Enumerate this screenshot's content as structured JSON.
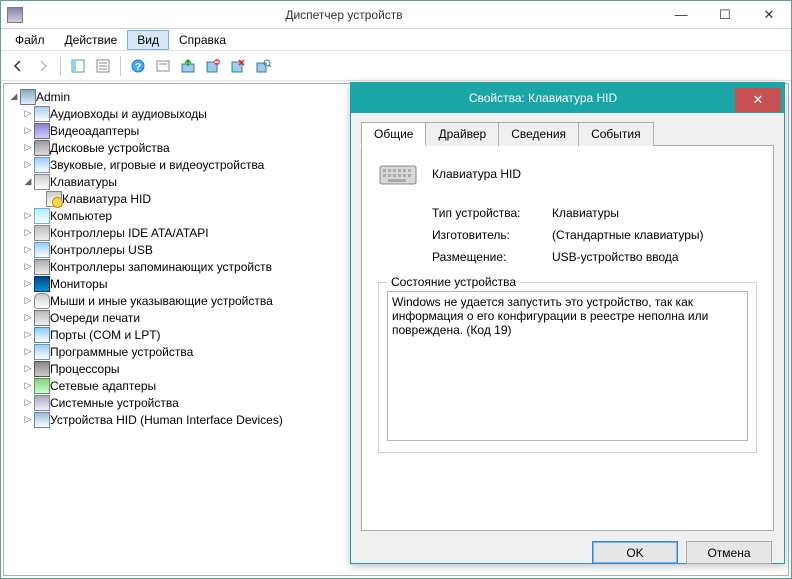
{
  "window": {
    "title": "Диспетчер устройств"
  },
  "menu": {
    "file": "Файл",
    "action": "Действие",
    "view": "Вид",
    "help": "Справка"
  },
  "tree": {
    "root": "Admin",
    "items": [
      {
        "label": "Аудиовходы и аудиовыходы",
        "icon": "audio"
      },
      {
        "label": "Видеоадаптеры",
        "icon": "video"
      },
      {
        "label": "Дисковые устройства",
        "icon": "disk"
      },
      {
        "label": "Звуковые, игровые и видеоустройства",
        "icon": "sound"
      },
      {
        "label": "Клавиатуры",
        "icon": "kbd",
        "expanded": true,
        "children": [
          {
            "label": "Клавиатура HID",
            "icon": "kbd-err"
          }
        ]
      },
      {
        "label": "Компьютер",
        "icon": "comp"
      },
      {
        "label": "Контроллеры IDE ATA/ATAPI",
        "icon": "ide"
      },
      {
        "label": "Контроллеры USB",
        "icon": "usb"
      },
      {
        "label": "Контроллеры запоминающих устройств",
        "icon": "storage"
      },
      {
        "label": "Мониторы",
        "icon": "monitor"
      },
      {
        "label": "Мыши и иные указывающие устройства",
        "icon": "mouse"
      },
      {
        "label": "Очереди печати",
        "icon": "print"
      },
      {
        "label": "Порты (COM и LPT)",
        "icon": "port"
      },
      {
        "label": "Программные устройства",
        "icon": "soft"
      },
      {
        "label": "Процессоры",
        "icon": "cpu"
      },
      {
        "label": "Сетевые адаптеры",
        "icon": "net"
      },
      {
        "label": "Системные устройства",
        "icon": "sys"
      },
      {
        "label": "Устройства HID (Human Interface Devices)",
        "icon": "hid"
      }
    ]
  },
  "dialog": {
    "title": "Свойства: Клавиатура HID",
    "tabs": {
      "general": "Общие",
      "driver": "Драйвер",
      "details": "Сведения",
      "events": "События"
    },
    "device_name": "Клавиатура HID",
    "prop_type_label": "Тип устройства:",
    "prop_type_value": "Клавиатуры",
    "prop_mfr_label": "Изготовитель:",
    "prop_mfr_value": "(Стандартные клавиатуры)",
    "prop_loc_label": "Размещение:",
    "prop_loc_value": "USB-устройство ввода",
    "status_group": "Состояние устройства",
    "status_text": "Windows не удается запустить это устройство, так как информация о его конфигурации в реестре неполна или повреждена. (Код 19)",
    "ok": "OK",
    "cancel": "Отмена"
  }
}
